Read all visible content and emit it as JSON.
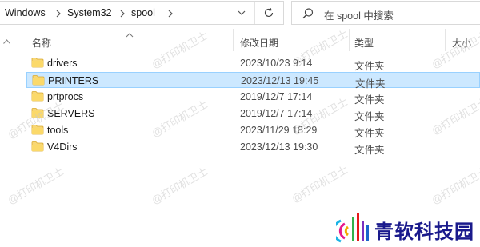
{
  "address": {
    "crumbs": [
      "Windows",
      "System32",
      "spool"
    ]
  },
  "search": {
    "placeholder": "在 spool 中搜索"
  },
  "columns": {
    "name": "名称",
    "date": "修改日期",
    "type": "类型",
    "size": "大小"
  },
  "files": [
    {
      "name": "drivers",
      "date": "2023/10/23 9:14",
      "type": "文件夹",
      "selected": false
    },
    {
      "name": "PRINTERS",
      "date": "2023/12/13 19:45",
      "type": "文件夹",
      "selected": true
    },
    {
      "name": "prtprocs",
      "date": "2019/12/7 17:14",
      "type": "文件夹",
      "selected": false
    },
    {
      "name": "SERVERS",
      "date": "2019/12/7 17:14",
      "type": "文件夹",
      "selected": false
    },
    {
      "name": "tools",
      "date": "2023/11/29 18:29",
      "type": "文件夹",
      "selected": false
    },
    {
      "name": "V4Dirs",
      "date": "2023/12/13 19:30",
      "type": "文件夹",
      "selected": false
    }
  ],
  "watermark": "@打印机卫士",
  "brand": {
    "name": "青软科技园"
  },
  "colors": {
    "selection_bg": "#cce8ff",
    "selection_border": "#99d1ff",
    "folder_yellow": "#f8d775",
    "brand_blue": "#1a1a8c"
  }
}
